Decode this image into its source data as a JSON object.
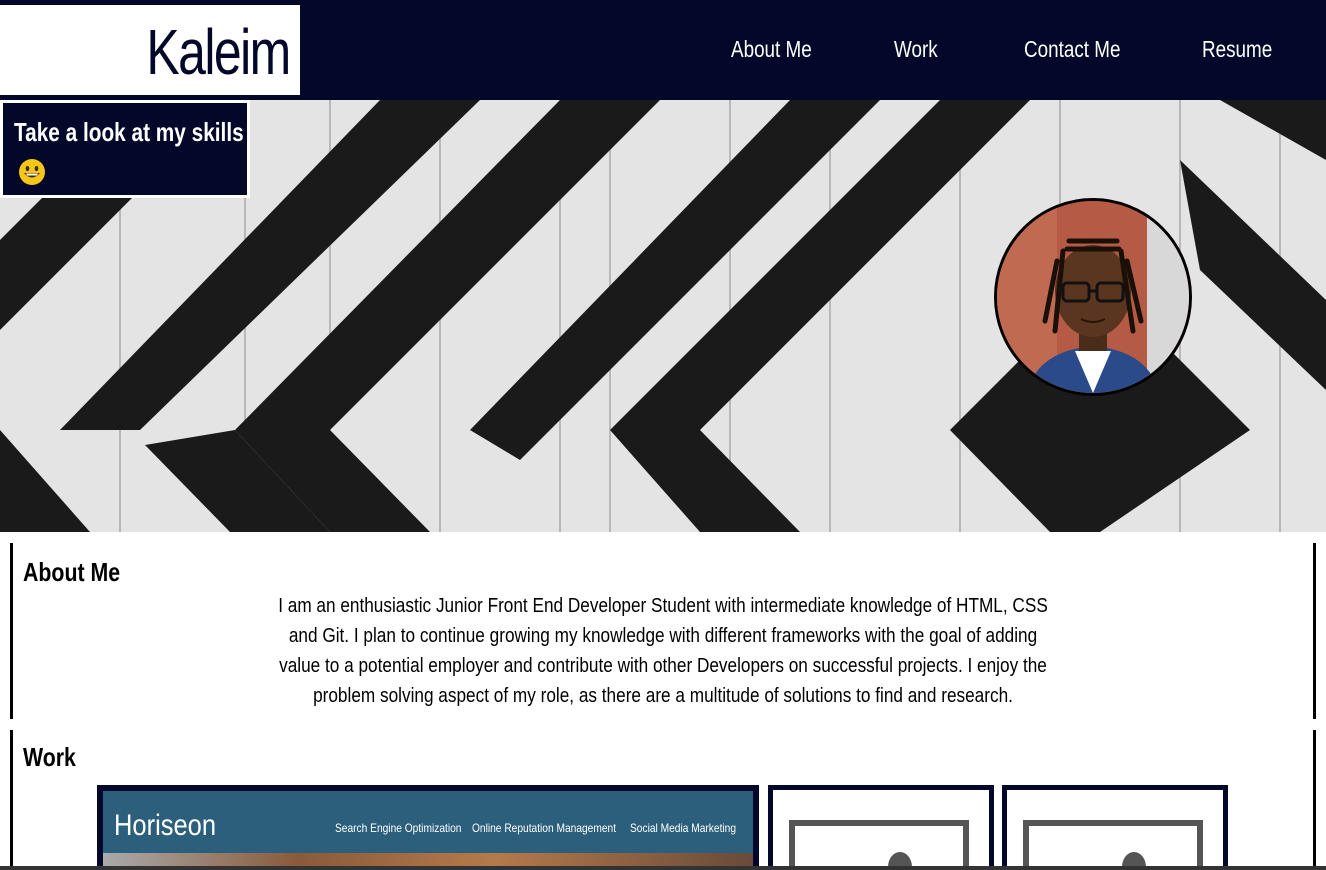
{
  "header": {
    "logo": "Kaleim",
    "nav": [
      "About Me",
      "Work",
      "Contact Me",
      "Resume"
    ]
  },
  "hero": {
    "skills_text": "Take a look at my skills",
    "skills_emoji": "grinning-face-icon",
    "avatar": "profile-photo"
  },
  "about": {
    "title": "About Me",
    "body": "I am an enthusiastic Junior Front End Developer Student with intermediate knowledge of HTML, CSS and Git. I plan to continue growing my knowledge with different frameworks with the goal of adding value to a potential employer and contribute with other Developers on successful projects. I enjoy the problem solving aspect of my role, as there are a multitude of solutions to find and research."
  },
  "work": {
    "title": "Work",
    "projects": [
      {
        "brand": "Horiseon",
        "nav": [
          "Search Engine Optimization",
          "Online Reputation Management",
          "Social Media Marketing"
        ]
      },
      {
        "thumbnail": "image-placeholder-icon"
      },
      {
        "thumbnail": "image-placeholder-icon"
      }
    ]
  },
  "colors": {
    "navy": "#03082a",
    "white": "#ffffff",
    "horiseon_teal": "#2c5f7c"
  }
}
